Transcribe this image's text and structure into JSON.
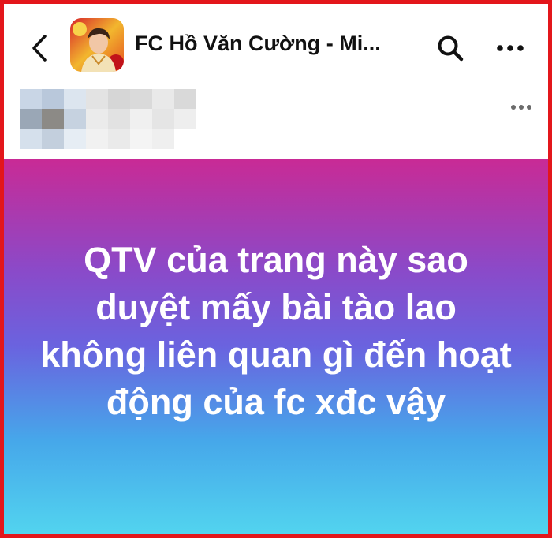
{
  "header": {
    "back_icon": "chevron-left-icon",
    "group_avatar": "group-avatar-photo",
    "group_title": "FC Hồ Văn Cường - Mi...",
    "search_icon": "search-icon",
    "more_icon": "more-horizontal-icon"
  },
  "post": {
    "author_avatar": "blurred-avatar",
    "author_name": "blurred-name",
    "more_icon": "more-horizontal-icon",
    "text": "QTV của trang này sao duyệt mấy bài tào lao không liên quan gì đến hoạt động của fc xđc vậy",
    "background_gradient": [
      "#c92a95",
      "#8a4ac9",
      "#6a63df",
      "#46a7ea",
      "#52d4ef"
    ]
  },
  "colors": {
    "frame_border": "#e3161b",
    "text_dark": "#111111",
    "post_text": "#ffffff"
  }
}
